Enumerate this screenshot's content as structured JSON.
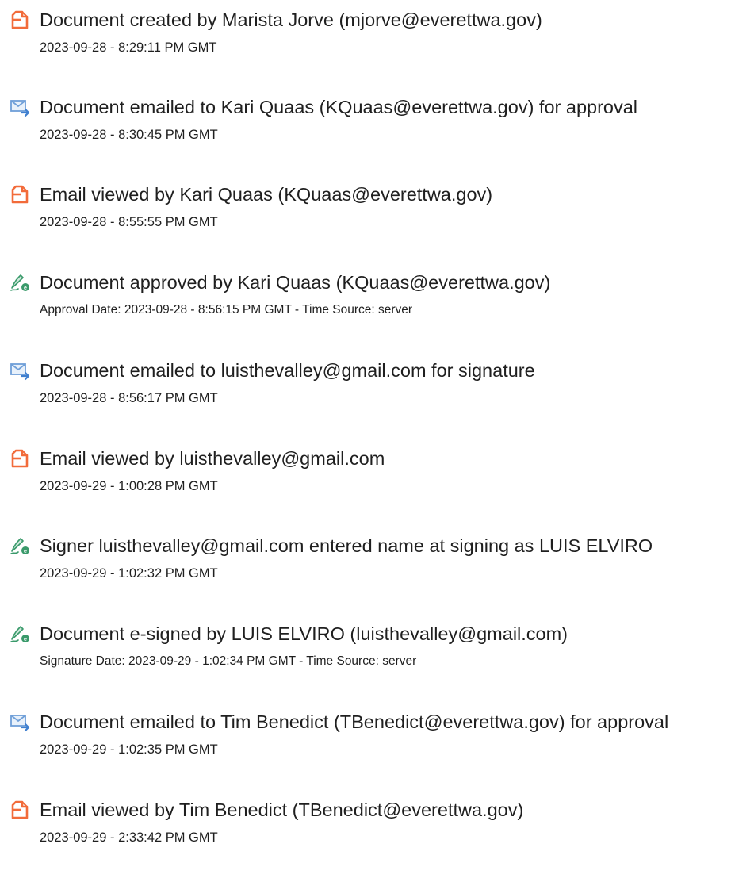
{
  "events": [
    {
      "icon": "document-icon",
      "title": "Document created by Marista Jorve (mjorve@everettwa.gov)",
      "detail": "2023-09-28 - 8:29:11 PM GMT"
    },
    {
      "icon": "email-icon",
      "title": "Document emailed to Kari Quaas (KQuaas@everettwa.gov) for approval",
      "detail": "2023-09-28 - 8:30:45 PM GMT"
    },
    {
      "icon": "document-icon",
      "title": "Email viewed by Kari Quaas (KQuaas@everettwa.gov)",
      "detail": "2023-09-28 - 8:55:55 PM GMT"
    },
    {
      "icon": "signature-icon",
      "title": "Document approved by Kari Quaas (KQuaas@everettwa.gov)",
      "detail": "Approval Date: 2023-09-28 - 8:56:15 PM GMT - Time Source: server"
    },
    {
      "icon": "email-icon",
      "title": "Document emailed to luisthevalley@gmail.com for signature",
      "detail": "2023-09-28 - 8:56:17 PM GMT"
    },
    {
      "icon": "document-icon",
      "title": "Email viewed by luisthevalley@gmail.com",
      "detail": "2023-09-29 - 1:00:28 PM GMT"
    },
    {
      "icon": "signature-icon",
      "title": "Signer luisthevalley@gmail.com entered name at signing as LUIS ELVIRO",
      "detail": "2023-09-29 - 1:02:32 PM GMT"
    },
    {
      "icon": "signature-icon",
      "title": "Document e-signed by LUIS ELVIRO (luisthevalley@gmail.com)",
      "detail": "Signature Date: 2023-09-29 - 1:02:34 PM GMT - Time Source: server"
    },
    {
      "icon": "email-icon",
      "title": "Document emailed to Tim Benedict (TBenedict@everettwa.gov) for approval",
      "detail": "2023-09-29 - 1:02:35 PM GMT"
    },
    {
      "icon": "document-icon",
      "title": "Email viewed by Tim Benedict (TBenedict@everettwa.gov)",
      "detail": "2023-09-29 - 2:33:42 PM GMT"
    }
  ],
  "colors": {
    "document_icon": "#f26b3a",
    "email_icon": "#6f9fd8",
    "signature_icon": "#3a9a6b"
  }
}
